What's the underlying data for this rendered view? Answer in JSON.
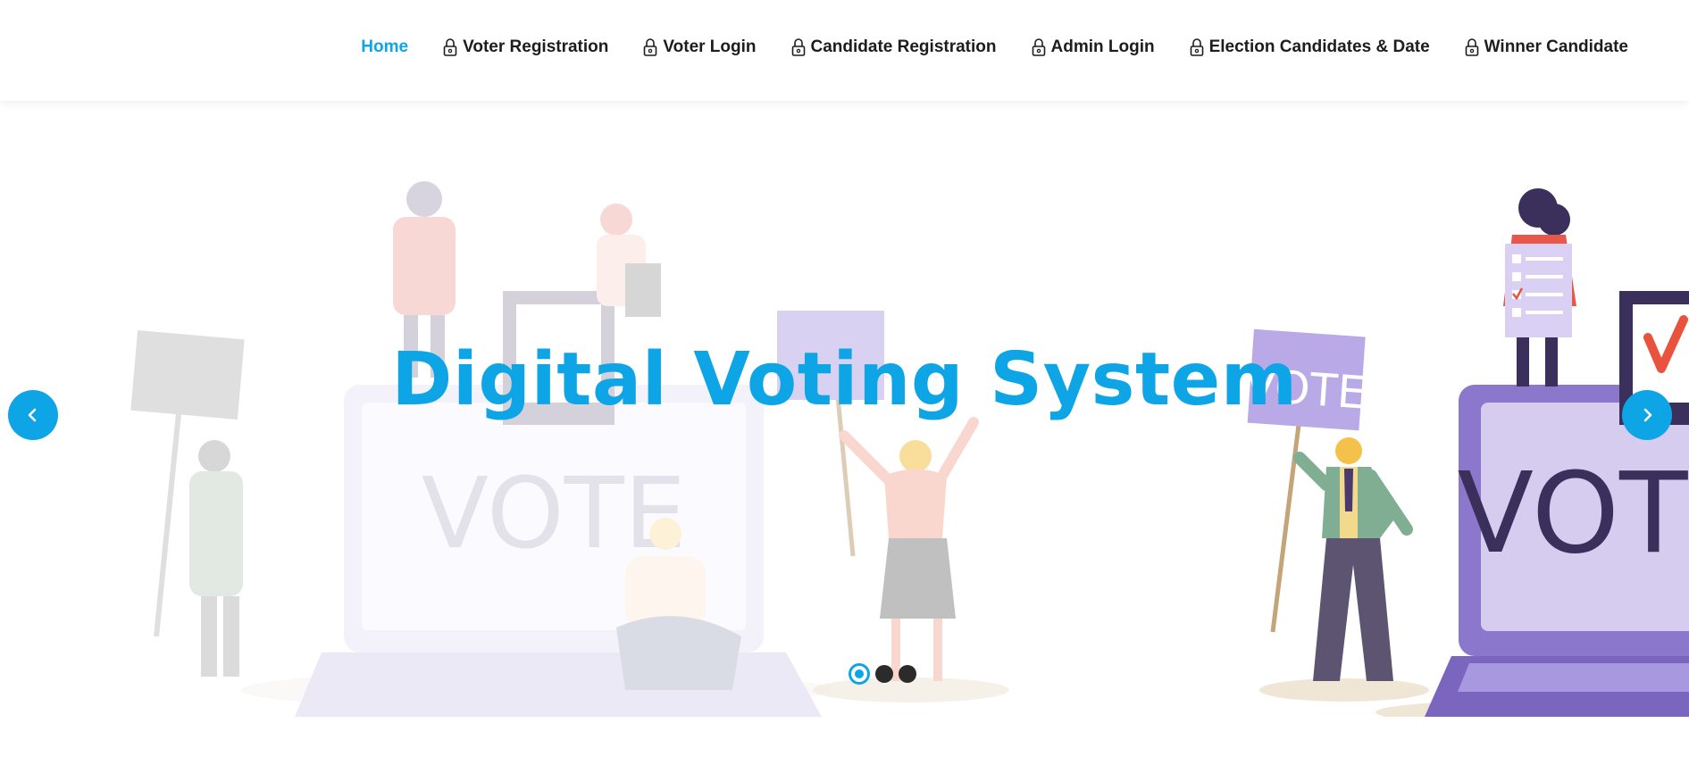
{
  "nav": {
    "items": [
      {
        "label": "Home",
        "icon": "",
        "active": true
      },
      {
        "label": "Voter Registration",
        "icon": "lock-icon"
      },
      {
        "label": "Voter Login",
        "icon": "lock-icon"
      },
      {
        "label": "Candidate Registration",
        "icon": "lock-icon"
      },
      {
        "label": "Admin Login",
        "icon": "lock-icon"
      },
      {
        "label": "Election Candidates & Date",
        "icon": "lock-icon"
      },
      {
        "label": "Winner Candidate",
        "icon": "lock-icon"
      }
    ]
  },
  "hero": {
    "title": "Digital Voting System",
    "sign_left": "VOTE",
    "sign_right": "VOTE",
    "screen_left": "VOTE",
    "screen_right": "VOTE",
    "slides_total": 3,
    "active_slide": 1
  },
  "colors": {
    "accent": "#0ea5e6",
    "nav_text": "#1d1d1d",
    "dot": "#2b2b2b",
    "laptop_purple": "#8b78cc"
  },
  "icons": {
    "prev": "chevron-left-icon",
    "next": "chevron-right-icon"
  }
}
